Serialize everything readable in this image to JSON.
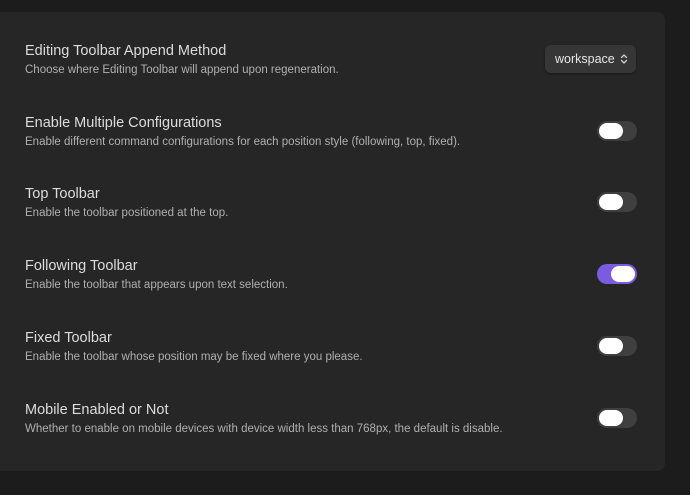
{
  "settings": [
    {
      "name": "Editing Toolbar Append Method",
      "desc": "Choose where Editing Toolbar will append upon regeneration.",
      "control": "dropdown",
      "value": "workspace"
    },
    {
      "name": "Enable Multiple Configurations",
      "desc": "Enable different command configurations for each position style (following, top, fixed).",
      "control": "toggle",
      "enabled": false
    },
    {
      "name": "Top Toolbar",
      "desc": "Enable the toolbar positioned at the top.",
      "control": "toggle",
      "enabled": false
    },
    {
      "name": "Following Toolbar",
      "desc": "Enable the toolbar that appears upon text selection.",
      "control": "toggle",
      "enabled": true
    },
    {
      "name": "Fixed Toolbar",
      "desc": "Enable the toolbar whose position may be fixed where you please.",
      "control": "toggle",
      "enabled": false
    },
    {
      "name": "Mobile Enabled or Not",
      "desc": "Whether to enable on mobile devices with device width less than 768px, the default is disable.",
      "control": "toggle",
      "enabled": false
    }
  ],
  "colors": {
    "accent": "#7b5ce0",
    "toggle_off": "#3f3f3f",
    "panel": "#262626",
    "background": "#1c1c1c"
  }
}
